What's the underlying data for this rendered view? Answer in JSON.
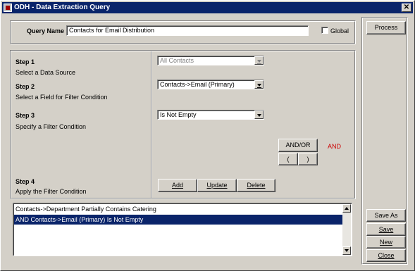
{
  "window": {
    "title": "ODH - Data Extraction Query",
    "close_glyph": "✕"
  },
  "query": {
    "name_label": "Query Name",
    "name_value": "Contacts for Email Distribution",
    "global_label": "Global",
    "global_checked": false
  },
  "steps": [
    {
      "title": "Step 1",
      "desc": "Select a Data Source"
    },
    {
      "title": "Step 2",
      "desc": "Select a Field for Filter Condition"
    },
    {
      "title": "Step 3",
      "desc": "Specify a Filter Condition"
    },
    {
      "title": "Step 4",
      "desc": "Apply the Filter Condition"
    }
  ],
  "fields": {
    "data_source": "All Contacts",
    "filter_field": "Contacts->Email (Primary)",
    "filter_condition": "Is Not Empty"
  },
  "logic": {
    "andor_label": "AND/OR",
    "open_paren": "(",
    "close_paren": ")",
    "current_operator": "AND",
    "operator_color": "#cc0000"
  },
  "actions": {
    "add": "Add",
    "update": "Update",
    "delete": "Delete"
  },
  "conditions": [
    {
      "text": "Contacts->Department Partially Contains Catering",
      "selected": false
    },
    {
      "text": "AND Contacts->Email (Primary) Is Not Empty",
      "selected": true
    }
  ],
  "side_buttons": {
    "process": "Process",
    "save_as": "Save As",
    "save": "Save",
    "new": "New",
    "close": "Close"
  }
}
